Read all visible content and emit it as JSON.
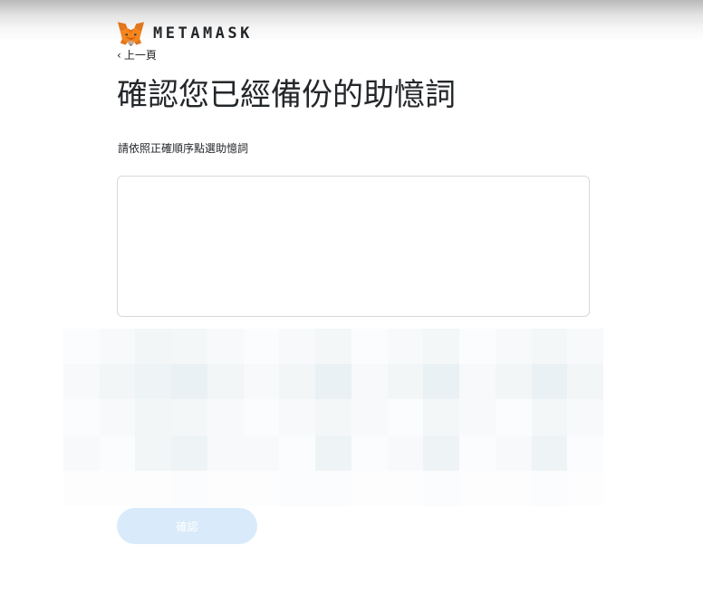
{
  "header": {
    "brand": "METAMASK",
    "logo_icon": "metamask-fox-icon"
  },
  "back": {
    "chevron": "‹",
    "label": "上一頁"
  },
  "title": "確認您已經備份的助憶詞",
  "instruction": "請依照正確順序點選助憶詞",
  "confirm_button": {
    "label": "確認",
    "state": "disabled",
    "background": "#d9ebfa"
  },
  "colors": {
    "text": "#24272a",
    "border": "#d6d9dc",
    "fox_orange": "#e2761b"
  }
}
